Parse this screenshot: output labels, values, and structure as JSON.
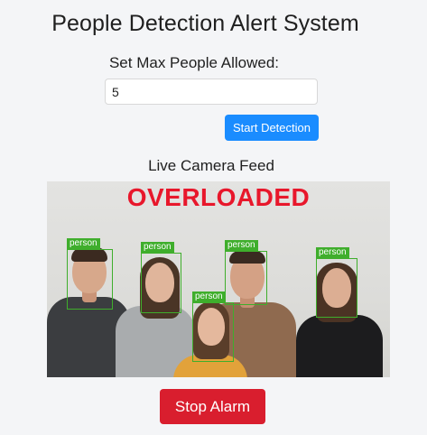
{
  "header": {
    "title": "People Detection Alert System"
  },
  "config": {
    "max_label": "Set Max People Allowed:",
    "max_value": "5"
  },
  "controls": {
    "start_label": "Start Detection",
    "stop_label": "Stop Alarm"
  },
  "feed": {
    "title": "Live Camera Feed",
    "status": "OVERLOADED",
    "detections": [
      {
        "label": "person"
      },
      {
        "label": "person"
      },
      {
        "label": "person"
      },
      {
        "label": "person"
      },
      {
        "label": "person"
      }
    ]
  },
  "colors": {
    "primary_button": "#1a8cff",
    "alarm_button": "#d91e2e",
    "status_text": "#e8172b",
    "detection_box": "#3fae2c"
  }
}
